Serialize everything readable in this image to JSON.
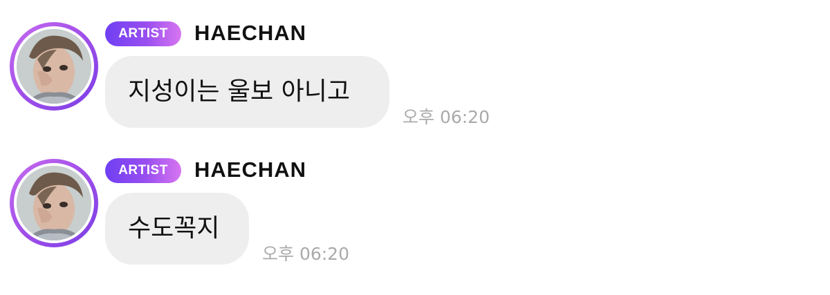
{
  "messages": [
    {
      "badge": "ARTIST",
      "name": "HAECHAN",
      "text": "지성이는 울보 아니고",
      "time": "오후 06:20",
      "avatar_icon": "profile-photo"
    },
    {
      "badge": "ARTIST",
      "name": "HAECHAN",
      "text": "수도꼭지",
      "time": "오후 06:20",
      "avatar_icon": "profile-photo"
    }
  ],
  "colors": {
    "badge_gradient_start": "#6f3ff2",
    "badge_gradient_end": "#d776f0",
    "bubble_bg": "#eeeeee",
    "timestamp": "#aaaaaa",
    "name": "#111111"
  }
}
